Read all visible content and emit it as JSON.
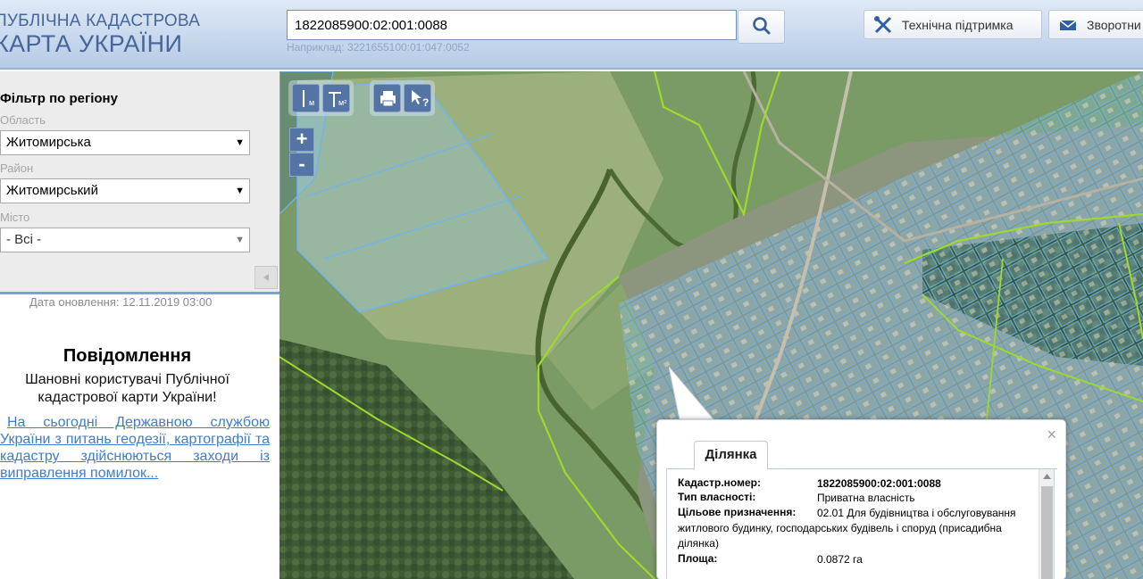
{
  "header": {
    "logo_line1": "ПУБЛІЧНА КАДАСТРОВА",
    "logo_line2": "КАРТА УКРАЇНИ",
    "search_value": "1822085900:02:001:0088",
    "search_hint": "Наприклад: 3221655100:01:047:0052",
    "search_icon": "magnifier-icon",
    "support_label": "Технічна підтримка",
    "feedback_label": "Зворотни"
  },
  "sidebar": {
    "filter_title": "Фільтр по регіону",
    "region_label": "Область",
    "region_value": "Житомирська",
    "district_label": "Район",
    "district_value": "Житомирський",
    "city_label": "Місто",
    "city_value": "- Всі -",
    "updated": "Дата оновлення: 12.11.2019 03:00",
    "notice_title": "Повідомлення",
    "notice_body": "Шановні користувачі Публічної кадастрової карти України!",
    "notice_link": "На сьогодні Державною службою України з питань геодезії, картографії та кадастру здійснюються заходи із виправлення помилок..."
  },
  "map": {
    "tools": [
      "ruler-icon",
      "area-measure-icon",
      "print-icon",
      "info-cursor-icon"
    ],
    "tool_labels": [
      "м",
      "м²",
      "?"
    ],
    "zoom_in": "+",
    "zoom_out": "-",
    "parcel_color": "#6fb4ef",
    "boundary_color": "#9ed92e"
  },
  "popup": {
    "tab": "Ділянка",
    "close": "×",
    "rows": [
      {
        "key": "Кадастр.номер:",
        "value": "1822085900:02:001:0088"
      },
      {
        "key": "Тип власності:",
        "value": "Приватна власність"
      },
      {
        "key": "Цільове призначення:",
        "value": "02.01 Для будівництва і обслуговування житлового будинку, господарських будівель і споруд (присадибна ділянка)"
      },
      {
        "key": "Площа:",
        "value": "0.0872 га"
      }
    ]
  }
}
